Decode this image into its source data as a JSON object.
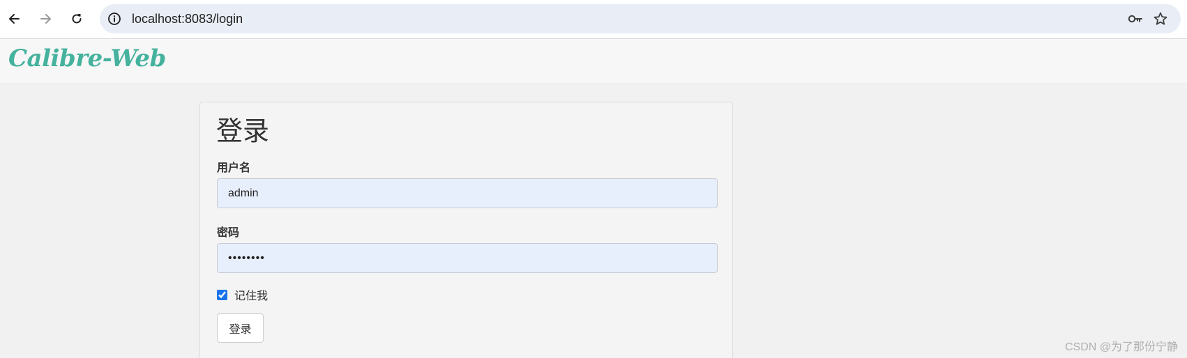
{
  "browser": {
    "url": "localhost:8083/login",
    "icons": {
      "back": "arrow-left-icon",
      "forward": "arrow-right-icon",
      "reload": "reload-icon",
      "site_info": "info-icon",
      "password_manager": "key-icon",
      "bookmark": "star-icon"
    }
  },
  "navbar": {
    "brand": "Calibre-Web",
    "brand_color": "#45b29d"
  },
  "login": {
    "title": "登录",
    "username_label": "用户名",
    "username_value": "admin",
    "password_label": "密码",
    "password_value": "••••••••",
    "remember_label": "记住我",
    "remember_checked": true,
    "submit_label": "登录"
  },
  "watermark": "CSDN @为了那份宁静"
}
